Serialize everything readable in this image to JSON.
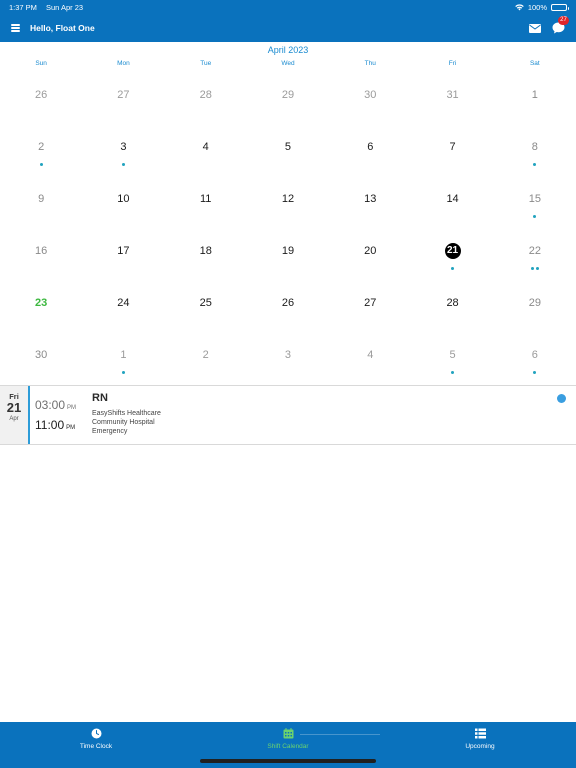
{
  "status_bar": {
    "time": "1:37 PM",
    "date": "Sun Apr 23",
    "battery": "100%"
  },
  "header": {
    "title": "Hello, Float One",
    "chat_badge": "27"
  },
  "calendar": {
    "month_title": "April 2023",
    "weekdays": [
      "Sun",
      "Mon",
      "Tue",
      "Wed",
      "Thu",
      "Fri",
      "Sat"
    ],
    "days": [
      {
        "label": "26",
        "muted": true,
        "dots": 0
      },
      {
        "label": "27",
        "muted": true,
        "dots": 0
      },
      {
        "label": "28",
        "muted": true,
        "dots": 0
      },
      {
        "label": "29",
        "muted": true,
        "dots": 0
      },
      {
        "label": "30",
        "muted": true,
        "dots": 0
      },
      {
        "label": "31",
        "muted": true,
        "dots": 0
      },
      {
        "label": "1",
        "weekend": true,
        "dots": 0
      },
      {
        "label": "2",
        "weekend": true,
        "dots": 1
      },
      {
        "label": "3",
        "dots": 1
      },
      {
        "label": "4",
        "dots": 0
      },
      {
        "label": "5",
        "dots": 0
      },
      {
        "label": "6",
        "dots": 0
      },
      {
        "label": "7",
        "dots": 0
      },
      {
        "label": "8",
        "weekend": true,
        "dots": 1
      },
      {
        "label": "9",
        "weekend": true,
        "dots": 0
      },
      {
        "label": "10",
        "dots": 0
      },
      {
        "label": "11",
        "dots": 0
      },
      {
        "label": "12",
        "dots": 0
      },
      {
        "label": "13",
        "dots": 0
      },
      {
        "label": "14",
        "dots": 0
      },
      {
        "label": "15",
        "weekend": true,
        "dots": 1
      },
      {
        "label": "16",
        "weekend": true,
        "dots": 0
      },
      {
        "label": "17",
        "dots": 0
      },
      {
        "label": "18",
        "dots": 0
      },
      {
        "label": "19",
        "dots": 0
      },
      {
        "label": "20",
        "dots": 0
      },
      {
        "label": "21",
        "selected": true,
        "dots": 1
      },
      {
        "label": "22",
        "weekend": true,
        "dots": 2
      },
      {
        "label": "23",
        "today": true,
        "dots": 0
      },
      {
        "label": "24",
        "dots": 0
      },
      {
        "label": "25",
        "dots": 0
      },
      {
        "label": "26",
        "dots": 0
      },
      {
        "label": "27",
        "dots": 0
      },
      {
        "label": "28",
        "dots": 0
      },
      {
        "label": "29",
        "weekend": true,
        "dots": 0
      },
      {
        "label": "30",
        "weekend": true,
        "dots": 0
      },
      {
        "label": "1",
        "muted": true,
        "dots": 1
      },
      {
        "label": "2",
        "muted": true,
        "dots": 0
      },
      {
        "label": "3",
        "muted": true,
        "dots": 0
      },
      {
        "label": "4",
        "muted": true,
        "dots": 0
      },
      {
        "label": "5",
        "muted": true,
        "dots": 1
      },
      {
        "label": "6",
        "muted": true,
        "dots": 1
      }
    ]
  },
  "shift": {
    "dow": "Fri",
    "day": "21",
    "month": "Apr",
    "start_time": "03:00",
    "start_ampm": "PM",
    "end_time": "11:00",
    "end_ampm": "PM",
    "role": "RN",
    "company": "EasyShifts Healthcare",
    "facility": "Community Hospital",
    "department": "Emergency"
  },
  "tabs": [
    {
      "label": "Time Clock",
      "icon": "clock-icon",
      "active": false
    },
    {
      "label": "Shift Calendar",
      "icon": "calendar-icon",
      "active": true
    },
    {
      "label": "Upcoming",
      "icon": "list-icon",
      "active": false
    }
  ],
  "colors": {
    "brand": "#0a72bd",
    "accent": "#1a8bd0",
    "today": "#3cb83f",
    "active_tab": "#6bd36e",
    "badge": "#e0262b"
  }
}
